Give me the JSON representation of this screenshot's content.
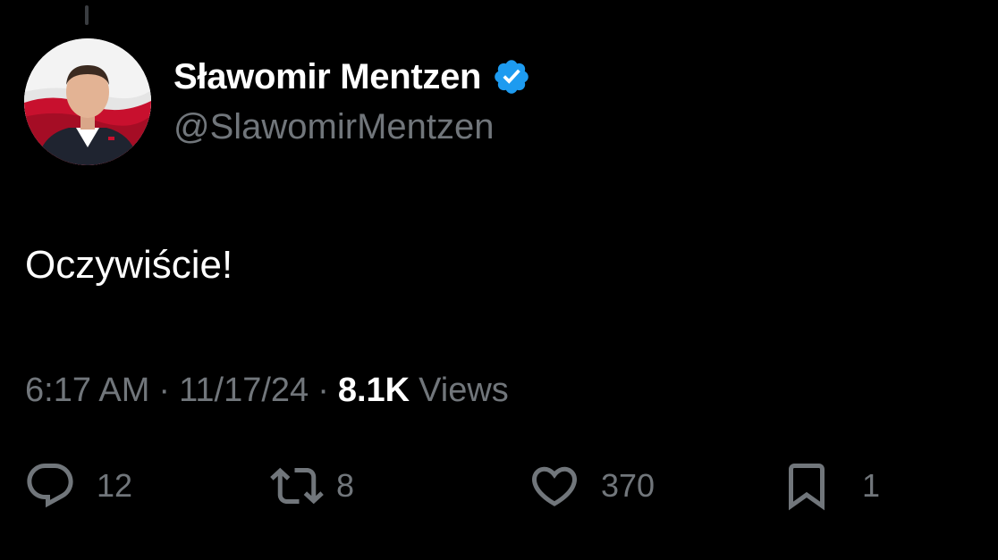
{
  "author": {
    "display_name": "Sławomir Mentzen",
    "handle": "@SlawomirMentzen",
    "verified": true,
    "verified_color": "#1d9bf0"
  },
  "tweet": {
    "text": "Oczywiście!",
    "time": "6:17 AM",
    "date": "11/17/24",
    "separator": "·",
    "views_count": "8.1K",
    "views_label": "Views"
  },
  "actions": {
    "reply": {
      "icon": "reply-icon",
      "count": "12"
    },
    "retweet": {
      "icon": "retweet-icon",
      "count": "8"
    },
    "like": {
      "icon": "heart-icon",
      "count": "370"
    },
    "bookmark": {
      "icon": "bookmark-icon",
      "count": "1"
    }
  },
  "colors": {
    "background": "#000000",
    "text_primary": "#ffffff",
    "text_secondary": "#71767b"
  }
}
